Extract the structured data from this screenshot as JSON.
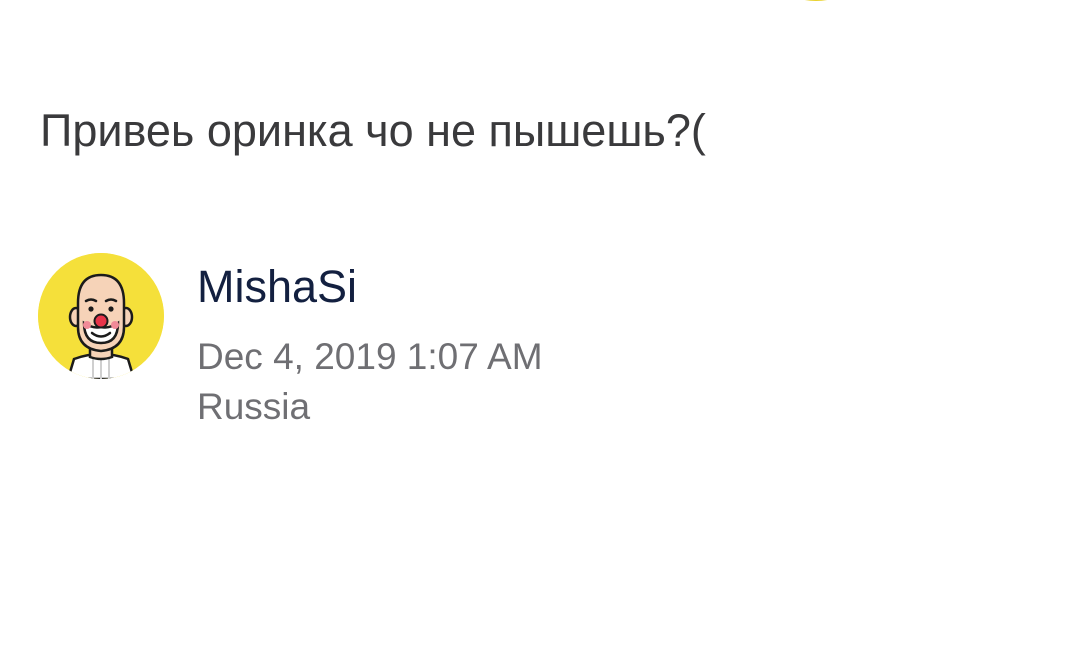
{
  "comment": {
    "text": "Привеь оринка чо не пышешь?(",
    "author": "MishaSi",
    "date": "Dec 4, 2019 1:07 AM",
    "location": "Russia",
    "avatar_icon": "clown-face-avatar-icon"
  },
  "colors": {
    "avatar_background": "#f5e03a",
    "text_primary": "#3a3a3c",
    "author_name": "#132040",
    "secondary_text": "#6f6f73",
    "clown_nose": "#e8344a"
  }
}
